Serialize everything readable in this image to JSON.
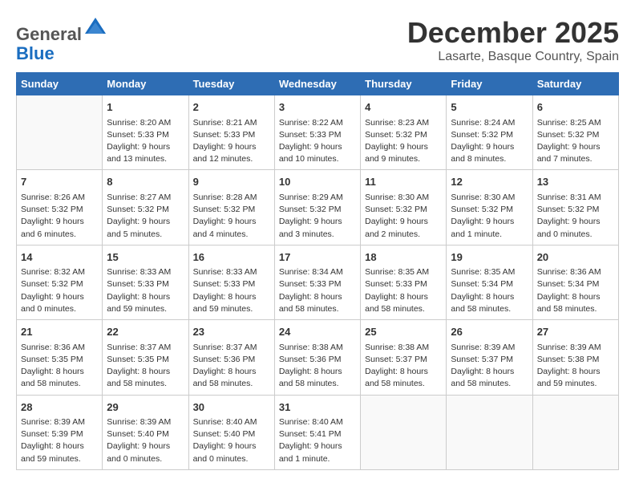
{
  "header": {
    "logo_general": "General",
    "logo_blue": "Blue",
    "month_title": "December 2025",
    "location": "Lasarte, Basque Country, Spain"
  },
  "days_of_week": [
    "Sunday",
    "Monday",
    "Tuesday",
    "Wednesday",
    "Thursday",
    "Friday",
    "Saturday"
  ],
  "weeks": [
    [
      {
        "day": "",
        "info": ""
      },
      {
        "day": "1",
        "info": "Sunrise: 8:20 AM\nSunset: 5:33 PM\nDaylight: 9 hours\nand 13 minutes."
      },
      {
        "day": "2",
        "info": "Sunrise: 8:21 AM\nSunset: 5:33 PM\nDaylight: 9 hours\nand 12 minutes."
      },
      {
        "day": "3",
        "info": "Sunrise: 8:22 AM\nSunset: 5:33 PM\nDaylight: 9 hours\nand 10 minutes."
      },
      {
        "day": "4",
        "info": "Sunrise: 8:23 AM\nSunset: 5:32 PM\nDaylight: 9 hours\nand 9 minutes."
      },
      {
        "day": "5",
        "info": "Sunrise: 8:24 AM\nSunset: 5:32 PM\nDaylight: 9 hours\nand 8 minutes."
      },
      {
        "day": "6",
        "info": "Sunrise: 8:25 AM\nSunset: 5:32 PM\nDaylight: 9 hours\nand 7 minutes."
      }
    ],
    [
      {
        "day": "7",
        "info": "Sunrise: 8:26 AM\nSunset: 5:32 PM\nDaylight: 9 hours\nand 6 minutes."
      },
      {
        "day": "8",
        "info": "Sunrise: 8:27 AM\nSunset: 5:32 PM\nDaylight: 9 hours\nand 5 minutes."
      },
      {
        "day": "9",
        "info": "Sunrise: 8:28 AM\nSunset: 5:32 PM\nDaylight: 9 hours\nand 4 minutes."
      },
      {
        "day": "10",
        "info": "Sunrise: 8:29 AM\nSunset: 5:32 PM\nDaylight: 9 hours\nand 3 minutes."
      },
      {
        "day": "11",
        "info": "Sunrise: 8:30 AM\nSunset: 5:32 PM\nDaylight: 9 hours\nand 2 minutes."
      },
      {
        "day": "12",
        "info": "Sunrise: 8:30 AM\nSunset: 5:32 PM\nDaylight: 9 hours\nand 1 minute."
      },
      {
        "day": "13",
        "info": "Sunrise: 8:31 AM\nSunset: 5:32 PM\nDaylight: 9 hours\nand 0 minutes."
      }
    ],
    [
      {
        "day": "14",
        "info": "Sunrise: 8:32 AM\nSunset: 5:32 PM\nDaylight: 9 hours\nand 0 minutes."
      },
      {
        "day": "15",
        "info": "Sunrise: 8:33 AM\nSunset: 5:33 PM\nDaylight: 8 hours\nand 59 minutes."
      },
      {
        "day": "16",
        "info": "Sunrise: 8:33 AM\nSunset: 5:33 PM\nDaylight: 8 hours\nand 59 minutes."
      },
      {
        "day": "17",
        "info": "Sunrise: 8:34 AM\nSunset: 5:33 PM\nDaylight: 8 hours\nand 58 minutes."
      },
      {
        "day": "18",
        "info": "Sunrise: 8:35 AM\nSunset: 5:33 PM\nDaylight: 8 hours\nand 58 minutes."
      },
      {
        "day": "19",
        "info": "Sunrise: 8:35 AM\nSunset: 5:34 PM\nDaylight: 8 hours\nand 58 minutes."
      },
      {
        "day": "20",
        "info": "Sunrise: 8:36 AM\nSunset: 5:34 PM\nDaylight: 8 hours\nand 58 minutes."
      }
    ],
    [
      {
        "day": "21",
        "info": "Sunrise: 8:36 AM\nSunset: 5:35 PM\nDaylight: 8 hours\nand 58 minutes."
      },
      {
        "day": "22",
        "info": "Sunrise: 8:37 AM\nSunset: 5:35 PM\nDaylight: 8 hours\nand 58 minutes."
      },
      {
        "day": "23",
        "info": "Sunrise: 8:37 AM\nSunset: 5:36 PM\nDaylight: 8 hours\nand 58 minutes."
      },
      {
        "day": "24",
        "info": "Sunrise: 8:38 AM\nSunset: 5:36 PM\nDaylight: 8 hours\nand 58 minutes."
      },
      {
        "day": "25",
        "info": "Sunrise: 8:38 AM\nSunset: 5:37 PM\nDaylight: 8 hours\nand 58 minutes."
      },
      {
        "day": "26",
        "info": "Sunrise: 8:39 AM\nSunset: 5:37 PM\nDaylight: 8 hours\nand 58 minutes."
      },
      {
        "day": "27",
        "info": "Sunrise: 8:39 AM\nSunset: 5:38 PM\nDaylight: 8 hours\nand 59 minutes."
      }
    ],
    [
      {
        "day": "28",
        "info": "Sunrise: 8:39 AM\nSunset: 5:39 PM\nDaylight: 8 hours\nand 59 minutes."
      },
      {
        "day": "29",
        "info": "Sunrise: 8:39 AM\nSunset: 5:40 PM\nDaylight: 9 hours\nand 0 minutes."
      },
      {
        "day": "30",
        "info": "Sunrise: 8:40 AM\nSunset: 5:40 PM\nDaylight: 9 hours\nand 0 minutes."
      },
      {
        "day": "31",
        "info": "Sunrise: 8:40 AM\nSunset: 5:41 PM\nDaylight: 9 hours\nand 1 minute."
      },
      {
        "day": "",
        "info": ""
      },
      {
        "day": "",
        "info": ""
      },
      {
        "day": "",
        "info": ""
      }
    ]
  ]
}
